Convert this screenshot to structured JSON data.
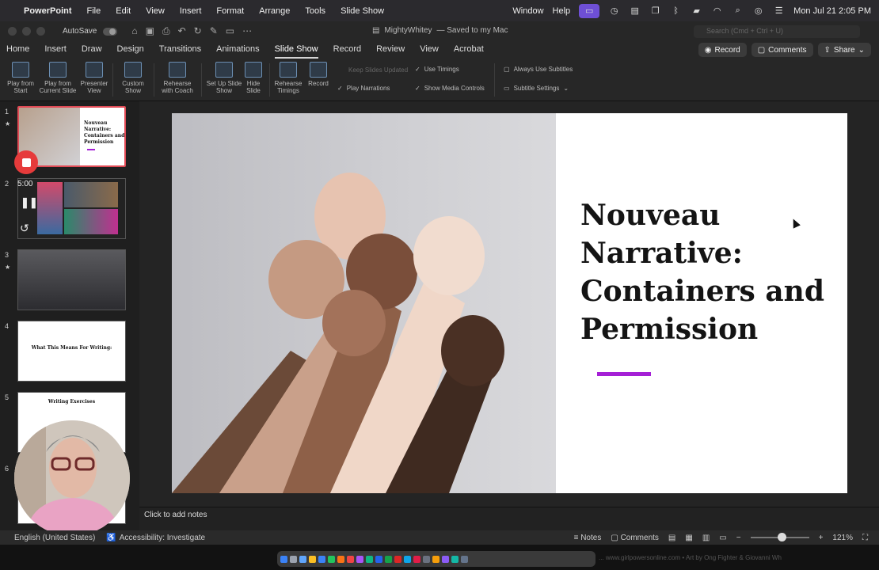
{
  "menubar": {
    "app_name": "PowerPoint",
    "items": [
      "File",
      "Edit",
      "View",
      "Insert",
      "Format",
      "Arrange",
      "Tools",
      "Slide Show"
    ],
    "right_items": [
      "Window",
      "Help"
    ],
    "datetime": "Mon Jul 21  2:05 PM"
  },
  "titlebar": {
    "autosave_label": "AutoSave",
    "doc_name": "MightyWhitey",
    "doc_status": "— Saved to my Mac",
    "search_placeholder": "Search (Cmd + Ctrl + U)"
  },
  "tabs": [
    "Home",
    "Insert",
    "Draw",
    "Design",
    "Transitions",
    "Animations",
    "Slide Show",
    "Record",
    "Review",
    "View",
    "Acrobat"
  ],
  "active_tab": "Slide Show",
  "tab_buttons": {
    "record": "Record",
    "comments": "Comments",
    "share": "Share"
  },
  "ribbon": {
    "play_from_start": "Play from Start",
    "play_current": "Play from Current Slide",
    "presenter_view": "Presenter View",
    "custom_show": "Custom Show",
    "rehearse_coach": "Rehearse with Coach",
    "setup_show": "Set Up Slide Show",
    "hide_slide": "Hide Slide",
    "rehearse_timings": "Rehearse Timings",
    "record": "Record",
    "keep_slides_updated": "Keep Slides Updated",
    "use_timings": "Use Timings",
    "play_narrations": "Play Narrations",
    "show_media_controls": "Show Media Controls",
    "always_use_subtitles": "Always Use Subtitles",
    "subtitle_settings": "Subtitle Settings"
  },
  "thumbnails": [
    {
      "num": "1",
      "title": "Nouveau Narrative: Containers and Permission"
    },
    {
      "num": "2",
      "title": ""
    },
    {
      "num": "3",
      "title": ""
    },
    {
      "num": "4",
      "title": "What This Means For Writing:"
    },
    {
      "num": "5",
      "title": "Writing Exercises"
    },
    {
      "num": "6",
      "title": ""
    }
  ],
  "recorder": {
    "timer": "5:00"
  },
  "slide": {
    "title": "Nouveau Narrative: Containers and Permission",
    "accent_color": "#a51fd6"
  },
  "notes": {
    "placeholder": "Click to add notes"
  },
  "statusbar": {
    "language": "English (United States)",
    "accessibility": "Accessibility: Investigate",
    "notes_label": "Notes",
    "comments_label": "Comments",
    "zoom": "121%"
  },
  "dock": {
    "caption": "... www.girlpowersonline.com • Art by Ong Fighter & Giovanni Wh"
  }
}
